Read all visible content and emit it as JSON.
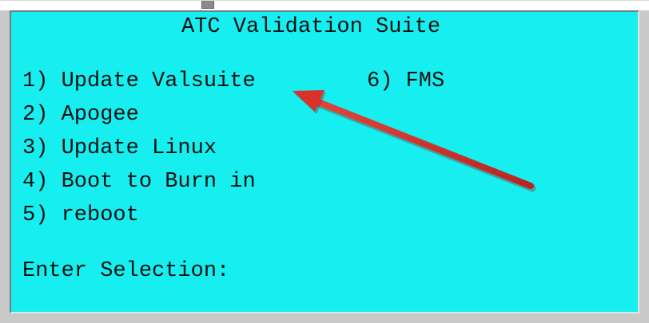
{
  "screen": {
    "title": "ATC Validation Suite",
    "menu": [
      {
        "label": "1) Update Valsuite"
      },
      {
        "label": "2) Apogee"
      },
      {
        "label": "3) Update Linux"
      },
      {
        "label": "4) Boot to Burn in"
      },
      {
        "label": "5) reboot"
      },
      {
        "label": "6) FMS"
      }
    ],
    "prompt": "Enter Selection:",
    "background_color": "#16eef0",
    "text_color": "#111111"
  },
  "annotation": {
    "arrow_color": "#d9322b",
    "icon": "red-arrow-icon"
  }
}
